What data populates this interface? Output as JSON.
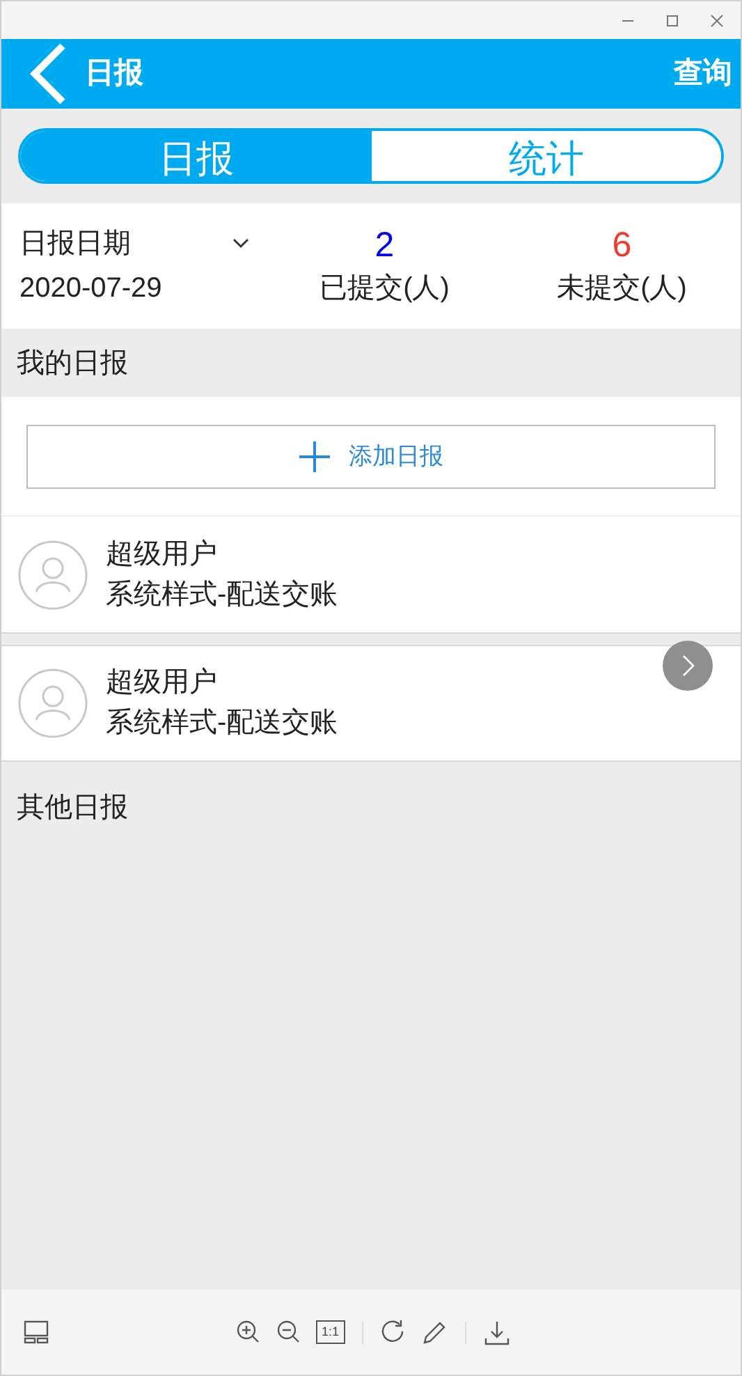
{
  "header": {
    "title": "日报",
    "action": "查询"
  },
  "tabs": [
    {
      "label": "日报",
      "selected": true
    },
    {
      "label": "统计",
      "selected": false
    }
  ],
  "summary": {
    "date_label": "日报日期",
    "date": "2020-07-29",
    "submitted_count": "2",
    "submitted_label": "已提交(人)",
    "pending_count": "6",
    "pending_label": "未提交(人)"
  },
  "my_reports": {
    "title": "我的日报",
    "add_button": "添加日报",
    "items": [
      {
        "name": "超级用户",
        "subtitle": "系统样式-配送交账"
      },
      {
        "name": "超级用户",
        "subtitle": "系统样式-配送交账"
      }
    ]
  },
  "other_reports": {
    "title": "其他日报"
  },
  "viewer_toolbar": {
    "actual_size": "1:1"
  }
}
